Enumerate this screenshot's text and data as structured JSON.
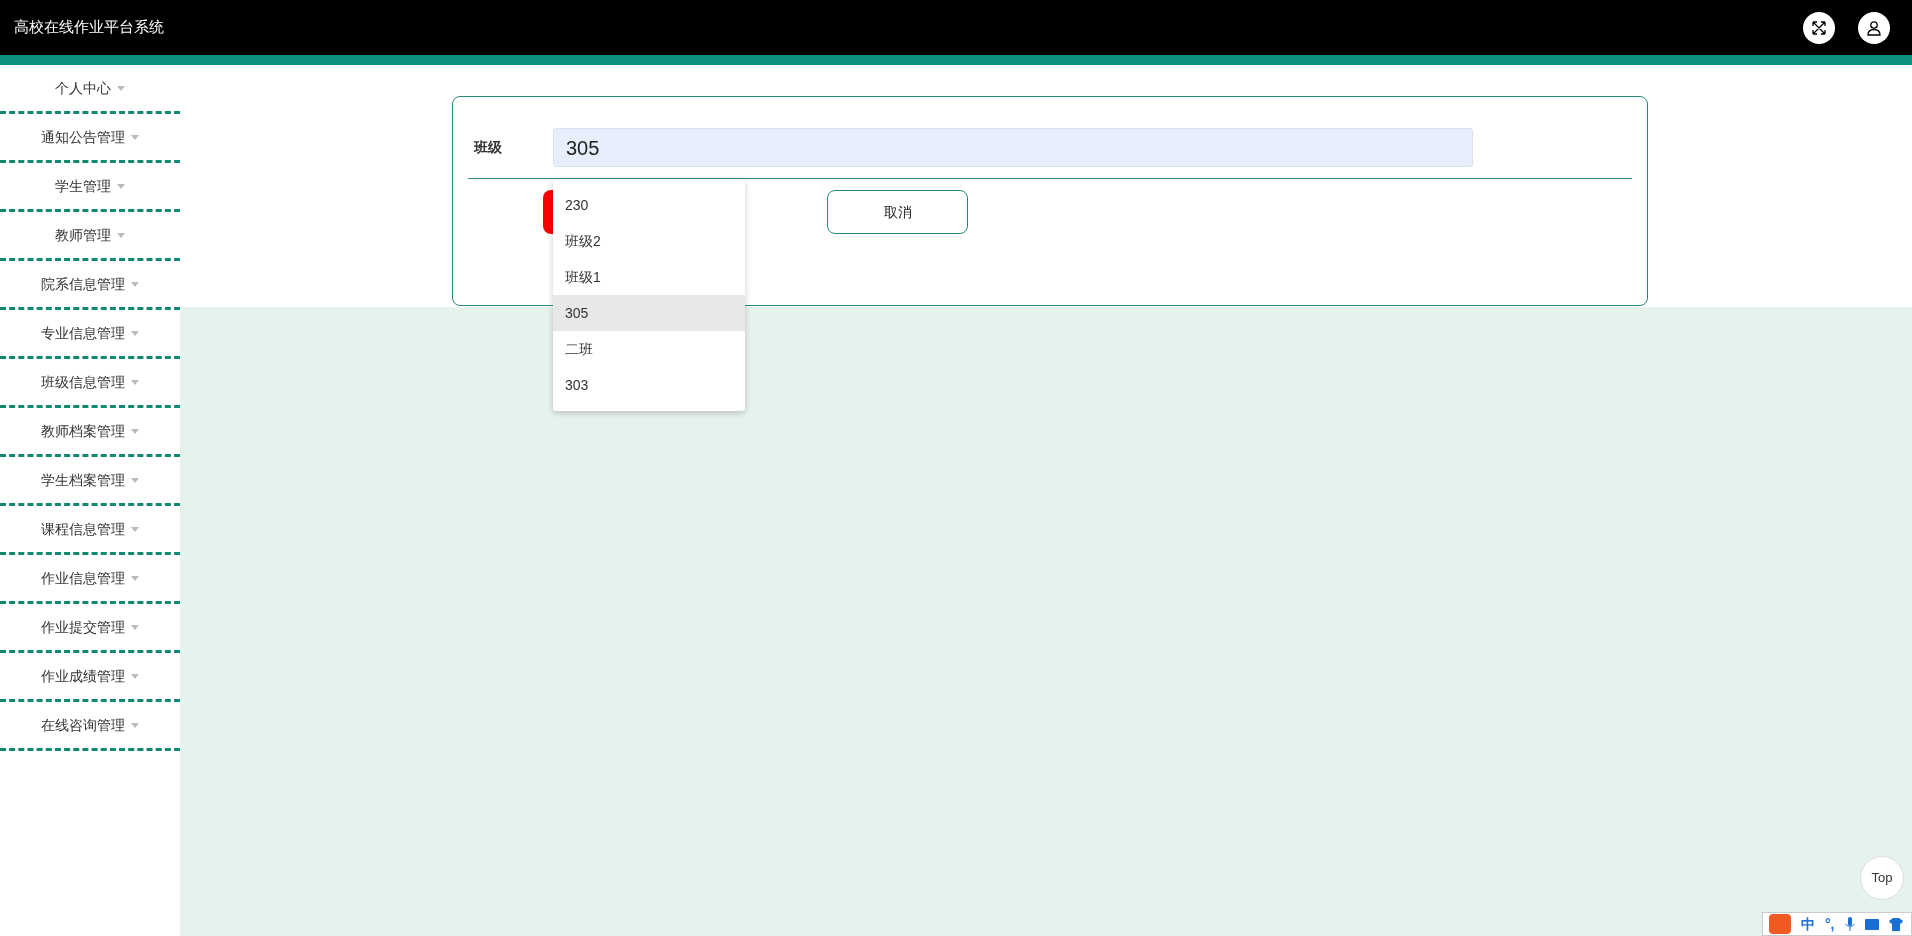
{
  "header": {
    "title": "高校在线作业平台系统"
  },
  "sidebar": {
    "items": [
      {
        "label": "个人中心"
      },
      {
        "label": "通知公告管理"
      },
      {
        "label": "学生管理"
      },
      {
        "label": "教师管理"
      },
      {
        "label": "院系信息管理"
      },
      {
        "label": "专业信息管理"
      },
      {
        "label": "班级信息管理"
      },
      {
        "label": "教师档案管理"
      },
      {
        "label": "学生档案管理"
      },
      {
        "label": "课程信息管理"
      },
      {
        "label": "作业信息管理"
      },
      {
        "label": "作业提交管理"
      },
      {
        "label": "作业成绩管理"
      },
      {
        "label": "在线咨询管理"
      }
    ]
  },
  "form": {
    "field": {
      "label": "班级",
      "value": "305"
    },
    "dropdown": {
      "options": [
        {
          "label": "230",
          "selected": false
        },
        {
          "label": "班级2",
          "selected": false
        },
        {
          "label": "班级1",
          "selected": false
        },
        {
          "label": "305",
          "selected": true
        },
        {
          "label": "二班",
          "selected": false
        },
        {
          "label": "303",
          "selected": false
        }
      ]
    },
    "buttons": [
      {
        "kind": "primary"
      },
      {
        "kind": "secondary",
        "label": "取消"
      }
    ]
  },
  "top_button": {
    "label": "Top"
  },
  "ime_toolbar": {
    "items": [
      "中",
      "°,"
    ]
  }
}
